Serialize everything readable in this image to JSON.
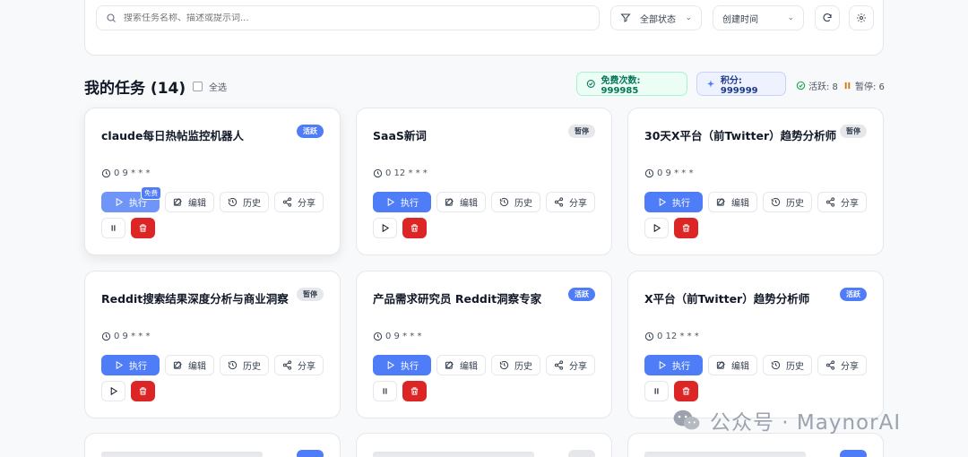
{
  "filters": {
    "search_placeholder": "搜索任务名称、描述或提示词...",
    "status_select": "全部状态",
    "sort_select": "创建时间"
  },
  "header": {
    "title": "我的任务 (14)",
    "select_all": "全选",
    "free_count": "免费次数: 999985",
    "points": "积分: 999999",
    "active_stat": "活跃: 8",
    "paused_stat": "暂停: 6"
  },
  "colors": {
    "primary": "#4f7cf7",
    "danger": "#dc2626",
    "success": "#047857"
  },
  "labels": {
    "run": "执行",
    "edit": "编辑",
    "history": "历史",
    "share": "分享",
    "free_tag": "免费"
  },
  "tasks": [
    {
      "title": "claude每日热帖监控机器人",
      "status": "活跃",
      "schedule": "0 9 * * *"
    },
    {
      "title": "SaaS新词",
      "status": "暂停",
      "schedule": "0 12 * * *"
    },
    {
      "title": "30天X平台（前Twitter）趋势分析师",
      "status": "暂停",
      "schedule": "0 9 * * *"
    },
    {
      "title": "Reddit搜索结果深度分析与商业洞察",
      "status": "暂停",
      "schedule": "0 9 * * *"
    },
    {
      "title": "产品需求研究员 Reddit洞察专家",
      "status": "活跃",
      "schedule": "0 9 * * *"
    },
    {
      "title": "X平台（前Twitter）趋势分析师",
      "status": "活跃",
      "schedule": "0 12 * * *"
    }
  ],
  "watermark": "公众号 · MaynorAI"
}
